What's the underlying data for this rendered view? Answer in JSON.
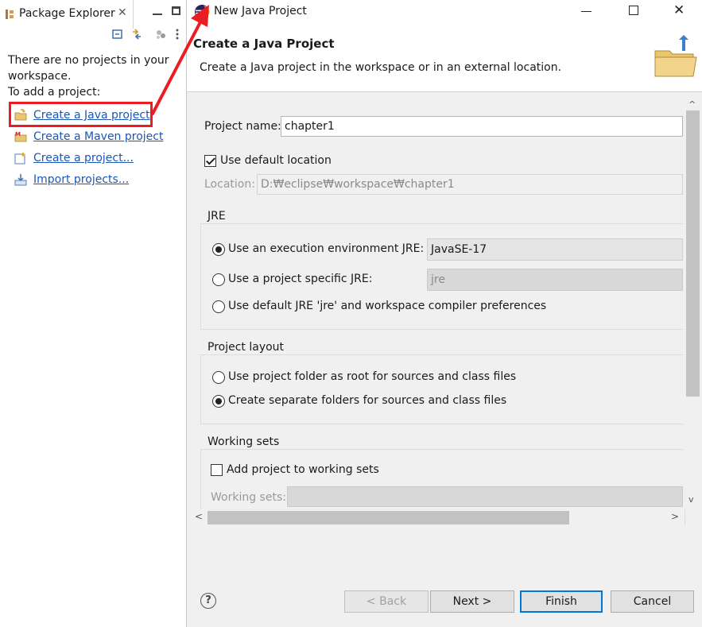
{
  "package_explorer": {
    "tab_title": "Package Explorer",
    "close_glyph": "✕",
    "message_line1": "There are no projects in your",
    "message_line2": "workspace.",
    "message_line3": "To add a project:",
    "links": [
      {
        "label": "Create a Java project",
        "icon": "java-project-icon"
      },
      {
        "label": "Create a Maven project",
        "icon": "maven-project-icon"
      },
      {
        "label": "Create a project...",
        "icon": "new-project-icon"
      },
      {
        "label": "Import projects...",
        "icon": "import-icon"
      }
    ]
  },
  "dialog": {
    "window_title": "New Java Project",
    "close_glyph": "✕",
    "banner_title": "Create a Java Project",
    "banner_description": "Create a Java project in the workspace or in an external location.",
    "project_name_label": "Project name:",
    "project_name_value": "chapter1",
    "use_default_location_label": "Use default location",
    "use_default_location_checked": true,
    "location_label": "Location:",
    "location_value": "D:₩eclipse₩workspace₩chapter1",
    "jre": {
      "group_title": "JRE",
      "option_exec_env": "Use an execution environment JRE:",
      "exec_env_value": "JavaSE-17",
      "option_project_specific": "Use a project specific JRE:",
      "project_specific_value": "jre",
      "option_default": "Use default JRE 'jre' and workspace compiler preferences",
      "selected": "exec_env"
    },
    "project_layout": {
      "group_title": "Project layout",
      "option_root": "Use project folder as root for sources and class files",
      "option_separate": "Create separate folders for sources and class files",
      "selected": "separate"
    },
    "working_sets": {
      "group_title": "Working sets",
      "add_label": "Add project to working sets",
      "add_checked": false,
      "sets_label": "Working sets:"
    },
    "buttons": {
      "help": "?",
      "back": "< Back",
      "next": "Next >",
      "finish": "Finish",
      "cancel": "Cancel"
    }
  },
  "colors": {
    "annotation": "#ec1c24",
    "link": "#1c56b8",
    "default_button_border": "#0078d7"
  }
}
